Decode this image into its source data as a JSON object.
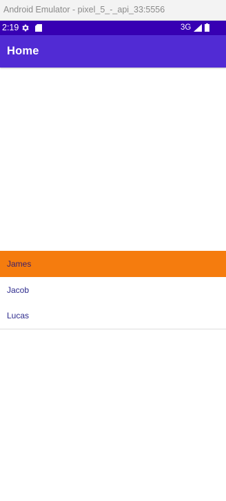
{
  "window": {
    "title": "Android Emulator - pixel_5_-_api_33:5556"
  },
  "status_bar": {
    "time": "2:19",
    "network": "3G"
  },
  "app_bar": {
    "title": "Home"
  },
  "list": {
    "selected_index": 0,
    "items": [
      {
        "label": "James"
      },
      {
        "label": "Jacob"
      },
      {
        "label": "Lucas"
      }
    ]
  },
  "colors": {
    "status_bar": "#3700b3",
    "app_bar": "#512bd4",
    "selected_item": "#f57c0e",
    "item_text": "#2c2a8c"
  }
}
